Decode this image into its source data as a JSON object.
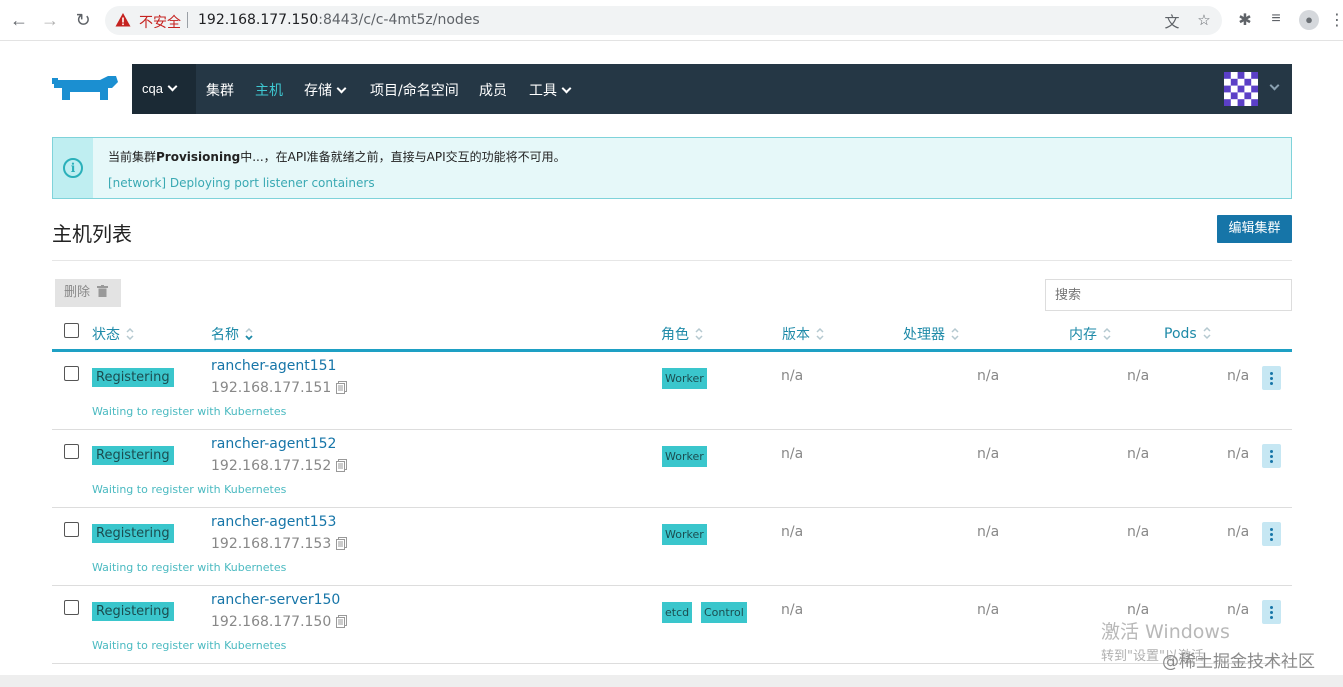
{
  "browser": {
    "security_label": "不安全",
    "url_host": "192.168.177.150",
    "url_rest": ":8443/c/c-4mt5z/nodes"
  },
  "topnav": {
    "cluster": "cqa",
    "items": [
      {
        "label": "集群",
        "dropdown": false,
        "active": false
      },
      {
        "label": "主机",
        "dropdown": false,
        "active": true
      },
      {
        "label": "存储",
        "dropdown": true,
        "active": false
      },
      {
        "label": "项目/命名空间",
        "dropdown": false,
        "active": false
      },
      {
        "label": "成员",
        "dropdown": false,
        "active": false
      },
      {
        "label": "工具",
        "dropdown": true,
        "active": false
      }
    ]
  },
  "banner": {
    "prefix": "当前集群",
    "status": "Provisioning",
    "suffix": "中...，在API准备就绪之前，直接与API交互的功能将不可用。",
    "detail": "[network] Deploying port listener containers"
  },
  "page": {
    "title": "主机列表",
    "edit_button": "编辑集群",
    "delete_button": "删除",
    "search_placeholder": "搜索"
  },
  "table": {
    "headers": [
      "状态",
      "名称",
      "角色",
      "版本",
      "处理器",
      "内存",
      "Pods"
    ],
    "rows": [
      {
        "status": "Registering",
        "message": "Waiting to register with Kubernetes",
        "name": "rancher-agent151",
        "ip": "192.168.177.151",
        "roles": [
          "Worker"
        ],
        "version": "n/a",
        "cpu": "n/a",
        "memory": "n/a",
        "pods": "n/a"
      },
      {
        "status": "Registering",
        "message": "Waiting to register with Kubernetes",
        "name": "rancher-agent152",
        "ip": "192.168.177.152",
        "roles": [
          "Worker"
        ],
        "version": "n/a",
        "cpu": "n/a",
        "memory": "n/a",
        "pods": "n/a"
      },
      {
        "status": "Registering",
        "message": "Waiting to register with Kubernetes",
        "name": "rancher-agent153",
        "ip": "192.168.177.153",
        "roles": [
          "Worker"
        ],
        "version": "n/a",
        "cpu": "n/a",
        "memory": "n/a",
        "pods": "n/a"
      },
      {
        "status": "Registering",
        "message": "Waiting to register with Kubernetes",
        "name": "rancher-server150",
        "ip": "192.168.177.150",
        "roles": [
          "etcd",
          "Control"
        ],
        "version": "n/a",
        "cpu": "n/a",
        "memory": "n/a",
        "pods": "n/a"
      }
    ]
  },
  "watermark": {
    "line1": "激活 Windows",
    "line2": "转到\"设置\"以激活",
    "credit": "@稀土掘金技术社区"
  }
}
